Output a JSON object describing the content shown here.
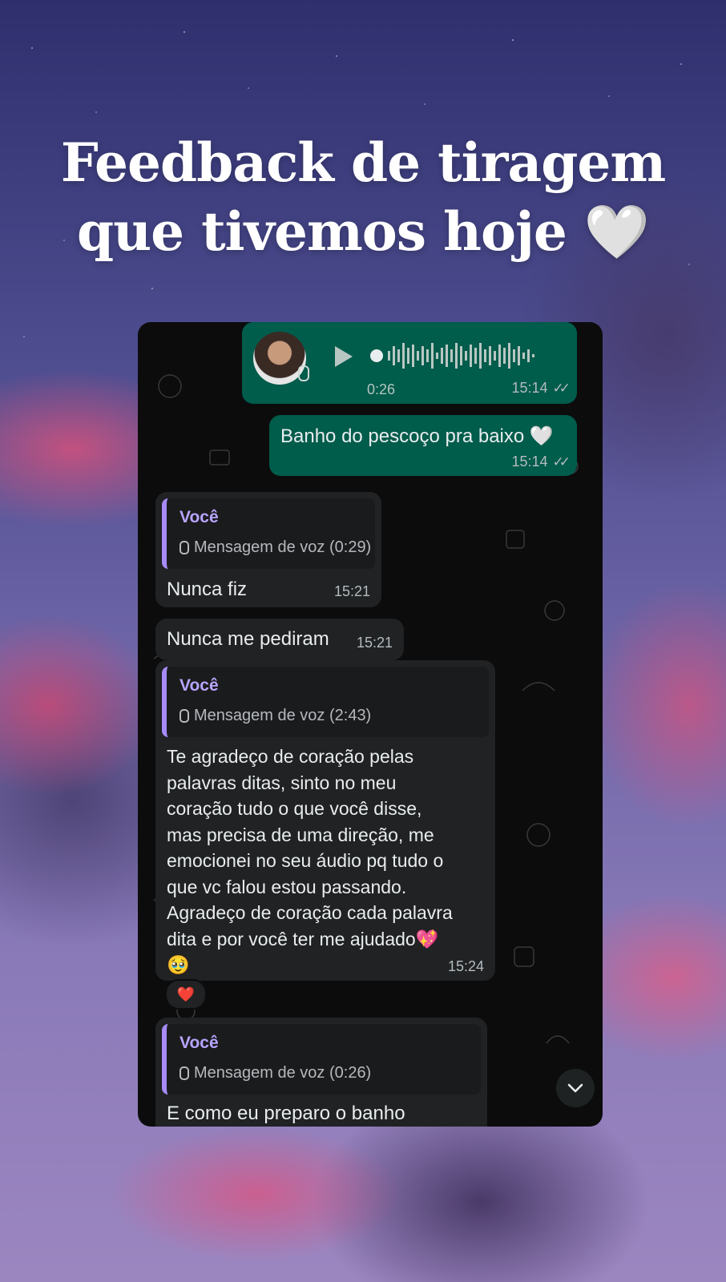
{
  "headline": {
    "line1": "Feedback de tiragem",
    "line2": "que tivemos hoje",
    "emoji": "🤍"
  },
  "chat": {
    "voice_note": {
      "duration": "0:26",
      "time": "15:14",
      "icons": [
        "avatar",
        "play-icon",
        "mic-icon",
        "double-check-icon"
      ]
    },
    "out_text": {
      "text": "Banho do pescoço pra baixo",
      "emoji": "🤍",
      "time": "15:14"
    },
    "reply1": {
      "quote_author": "Você",
      "quote_text": "Mensagem de voz (0:29)",
      "text": "Nunca fiz",
      "time": "15:21"
    },
    "msg2": {
      "text": "Nunca me pediram",
      "time": "15:21"
    },
    "reply2": {
      "quote_author": "Você",
      "quote_text": "Mensagem de voz (2:43)",
      "lines": [
        "Te agradeço de coração pelas",
        "palavras ditas, sinto no meu",
        "coração tudo o que você disse,",
        "mas precisa de uma direção, me",
        "emocionei no seu áudio pq tudo o",
        "que vc falou estou passando.",
        "Agradeço de coração cada palavra",
        "dita e por você ter me ajudado💖",
        "🥹"
      ],
      "time": "15:24",
      "reaction": "❤️"
    },
    "reply3": {
      "quote_author": "Você",
      "quote_text": "Mensagem de voz (0:26)",
      "text": "E como eu preparo o banho"
    },
    "colors": {
      "outgoing": "#005c4b",
      "incoming": "#202223",
      "quote_accent": "#a78bfa"
    }
  }
}
